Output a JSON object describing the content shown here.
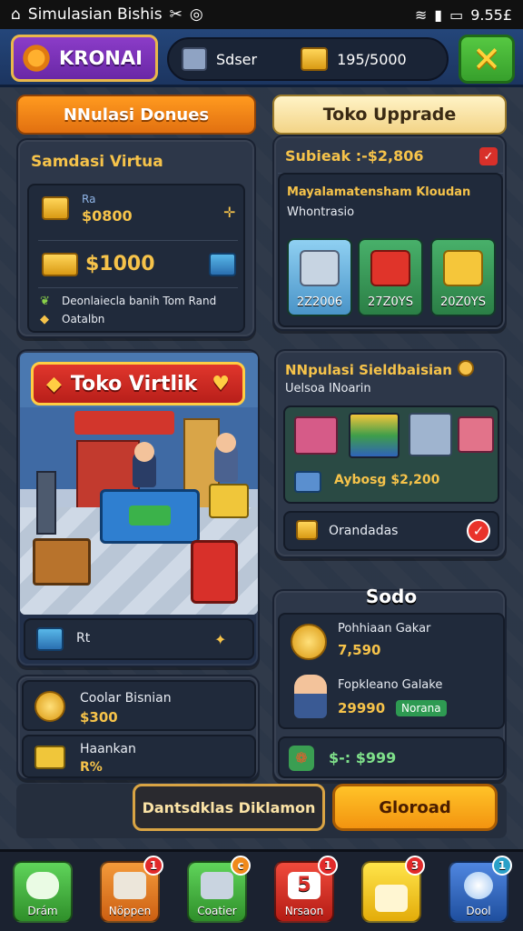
{
  "status_bar": {
    "app_label": "Simulasian Bishis",
    "time": "9.55£"
  },
  "header": {
    "brand": "KRONAI",
    "stat_one": "Sdser",
    "stat_two": "195/5000"
  },
  "tabs": {
    "left": "NNulasi Donues",
    "right": "Toko Upprade"
  },
  "left_panel": {
    "title": "Samdasi Virtua",
    "row1_label": "Ra",
    "row1_value": "$0800",
    "row2_value": "$1000",
    "note_line1": "Deonlaiecla banih Tom Rand",
    "note_line2": "Oatalbn"
  },
  "upgrade_panel": {
    "header": "Subieak :-$2,806",
    "desc_line1": "Mayalamatensham Kloudan",
    "desc_line2": "Whontrasio",
    "cards": [
      {
        "label": "2Z2006",
        "color": "#5aa9d8"
      },
      {
        "label": "27Z0YS",
        "color": "#2f8a4e"
      },
      {
        "label": "20Z0YS",
        "color": "#2f8a4e"
      }
    ]
  },
  "store": {
    "title": "Toko Virtlik",
    "footer_label": "Rt"
  },
  "sim_panel": {
    "title": "NNpulasi Sieldbaisian",
    "subtitle": "Uelsoa INoarin",
    "price": "Aybosg $2,200",
    "option_label": "Orandadas"
  },
  "left_bottom": {
    "item1_title": "Coolar Bisnian",
    "item1_value": "$300",
    "item2_title": "Haankan",
    "item2_value": "R%"
  },
  "stock_panel": {
    "title": "Sodo",
    "item1_title": "Pohhiaan Gakar",
    "item1_value": "7,590",
    "item2_title": "Fopkleano Galake",
    "item2_value": "29990",
    "item2_tag": "Norana",
    "footer_value": "$-: $999"
  },
  "actions": {
    "secondary": "Dantsdklas Diklamon",
    "primary": "Gloroad"
  },
  "bottom_nav": [
    {
      "label": "Drám",
      "badge": "",
      "color": "#3fa43a"
    },
    {
      "label": "Nöppen",
      "badge": "1",
      "color": "#e77a1c"
    },
    {
      "label": "Coatier",
      "badge": "c",
      "color": "#3fa43a"
    },
    {
      "label": "Nrsaon",
      "badge": "1",
      "color": "#d8302a"
    },
    {
      "label": "",
      "badge": "3",
      "color": "#f5c518"
    },
    {
      "label": "Dool",
      "badge": "1",
      "color": "#2f63b8"
    }
  ]
}
